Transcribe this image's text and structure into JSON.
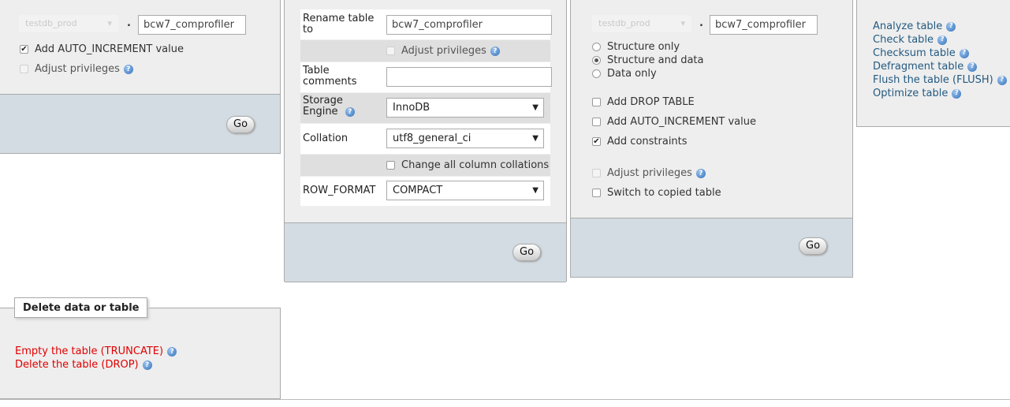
{
  "panel_move": {
    "db_select_value": "testdb_prod",
    "dot": ".",
    "table_name_value": "bcw7_comprofiler",
    "add_auto_increment_label": "Add AUTO_INCREMENT value",
    "adjust_privileges_label": "Adjust privileges",
    "go_label": "Go"
  },
  "panel_options": {
    "rename_table_label": "Rename table to",
    "rename_table_value": "bcw7_comprofiler",
    "adjust_privileges_label": "Adjust privileges",
    "table_comments_label": "Table comments",
    "table_comments_value": "",
    "storage_engine_label": "Storage Engine",
    "storage_engine_value": "InnoDB",
    "collation_label": "Collation",
    "collation_value": "utf8_general_ci",
    "change_all_collations_label": "Change all column collations",
    "row_format_label": "ROW_FORMAT",
    "row_format_value": "COMPACT",
    "go_label": "Go"
  },
  "panel_copy": {
    "db_select_value": "testdb_prod",
    "dot": ".",
    "table_name_value": "bcw7_comprofiler",
    "structure_only_label": "Structure only",
    "structure_and_data_label": "Structure and data",
    "data_only_label": "Data only",
    "add_drop_table_label": "Add DROP TABLE",
    "add_auto_increment_label": "Add AUTO_INCREMENT value",
    "add_constraints_label": "Add constraints",
    "adjust_privileges_label": "Adjust privileges",
    "switch_to_copied_label": "Switch to copied table",
    "go_label": "Go"
  },
  "panel_maintenance": {
    "items": [
      "Analyze table",
      "Check table",
      "Checksum table",
      "Defragment table",
      "Flush the table (FLUSH)",
      "Optimize table"
    ]
  },
  "panel_delete": {
    "legend": "Delete data or table",
    "truncate_label": "Empty the table (TRUNCATE)",
    "drop_label": "Delete the table (DROP)"
  },
  "icons": {
    "help": "help-icon",
    "check": "✔",
    "help_glyph": "?",
    "arrow": "▼",
    "blur_arrow": "▾"
  },
  "colors": {
    "link": "#235a81",
    "danger_link": "#e00000",
    "panel_bg": "#eeeeee",
    "panel_footer": "#d3dce3"
  }
}
